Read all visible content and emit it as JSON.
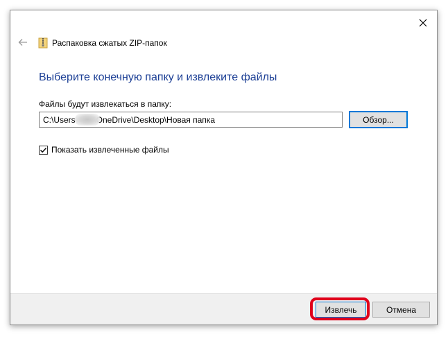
{
  "dialog": {
    "title": "Распаковка сжатых ZIP-папок",
    "heading": "Выберите конечную папку и извлеките файлы",
    "field_label": "Файлы будут извлекаться в папку:",
    "path_value": "C:\\Users        \\OneDrive\\Desktop\\Новая папка",
    "browse_label": "Обзор...",
    "checkbox_label": "Показать извлеченные файлы",
    "checkbox_checked": true
  },
  "footer": {
    "extract_label": "Извлечь",
    "cancel_label": "Отмена"
  },
  "colors": {
    "heading": "#1c3f95",
    "accent": "#0078d7",
    "highlight": "#e0001b"
  },
  "icons": {
    "close": "close-icon",
    "back": "back-arrow-icon",
    "zip": "zip-folder-icon",
    "check": "checkmark-icon"
  }
}
